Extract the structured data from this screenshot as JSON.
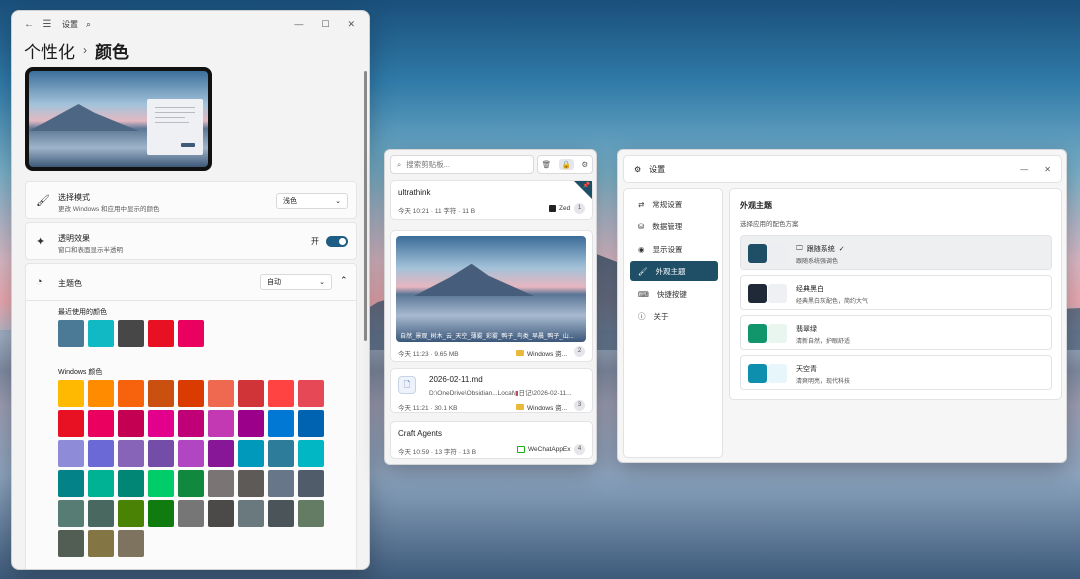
{
  "settings_window": {
    "app_title": "设置",
    "breadcrumb_parent": "个性化",
    "breadcrumb_sep": "›",
    "breadcrumb_current": "颜色",
    "mode": {
      "title": "选择模式",
      "subtitle": "更改 Windows 和应用中显示的颜色",
      "value": "浅色"
    },
    "transparency": {
      "title": "透明效果",
      "subtitle": "窗口和表面显示半透明",
      "state_label": "开",
      "on": true
    },
    "accent": {
      "title": "主题色",
      "value": "自动"
    },
    "recent_label": "最近使用的颜色",
    "recent_colors": [
      "#4a7a96",
      "#10b9c4",
      "#474747",
      "#e81123",
      "#ea005e"
    ],
    "windows_label": "Windows 颜色",
    "windows_colors": [
      [
        "#ffb900",
        "#ff8c00",
        "#f7630c",
        "#ca5010",
        "#da3b01",
        "#ef6950",
        "#d13438",
        "#ff4343",
        "#e74856"
      ],
      [
        "#e81123",
        "#ea005e",
        "#c30052",
        "#e3008c",
        "#bf0077",
        "#c239b3",
        "#9a0089",
        "#0078d4",
        "#0063b1"
      ],
      [
        "#8e8cd8",
        "#6b69d6",
        "#8764b8",
        "#744da9",
        "#b146c2",
        "#881798",
        "#0099bc",
        "#2d7d9a",
        "#00b7c3"
      ],
      [
        "#038387",
        "#00b294",
        "#018574",
        "#00cc6a",
        "#10893e",
        "#7a7574",
        "#5d5a58",
        "#68768a",
        "#515c6b"
      ],
      [
        "#567c73",
        "#486860",
        "#498205",
        "#107c10",
        "#767676",
        "#4c4a48",
        "#69797e",
        "#4a5459",
        "#647c64"
      ],
      [
        "#525e54",
        "#847545",
        "#7e735f"
      ]
    ]
  },
  "clipboard": {
    "search_placeholder": "搜索剪贴板...",
    "items": [
      {
        "title": "ultrathink",
        "time": "今天 10:21",
        "size": "11 字符",
        "bytes": "11 B",
        "source": "Zed",
        "count": "1",
        "pinned": true
      },
      {
        "caption": "自然_景观_树木_云_天空_薄雾_彩雾_鸭子_鸟类_早晨_鸭子_山...",
        "time": "今天 11:23",
        "size": "9.65 MB",
        "source": "Windows 资...",
        "count": "2"
      },
      {
        "title": "2026-02-11.md",
        "path": "D:\\OneDrive\\Obsidian...Local\\",
        "path2": "日记\\2026-02-11...",
        "time": "今天 11:21",
        "size": "30.1 KB",
        "source": "Windows 资...",
        "count": "3"
      },
      {
        "title": "Craft Agents",
        "time": "今天 10:59",
        "size": "13 字符",
        "bytes": "13 B",
        "source": "WeChatAppEx",
        "count": "4"
      }
    ]
  },
  "app_settings": {
    "title": "设置",
    "nav": [
      "常规设置",
      "数据管理",
      "显示设置",
      "外观主题",
      "快捷按键",
      "关于"
    ],
    "active_nav": "外观主题",
    "section_title": "外观主题",
    "section_sub": "选择应用的配色方案",
    "themes": [
      {
        "name": "跟随系统",
        "desc": "跟随系统强调色",
        "c1": "#1f4e67",
        "c2": "#eceef1",
        "selected": true
      },
      {
        "name": "经典黑白",
        "desc": "经典黑白灰配色，简约大气",
        "c1": "#1f2937",
        "c2": "#eef0f3",
        "selected": false
      },
      {
        "name": "翡翠绿",
        "desc": "清新自然，护眼舒适",
        "c1": "#10966a",
        "c2": "#e8f6ef",
        "selected": false
      },
      {
        "name": "天空青",
        "desc": "清爽明亮，现代科技",
        "c1": "#0e8fae",
        "c2": "#e6f6fa",
        "selected": false
      }
    ]
  }
}
